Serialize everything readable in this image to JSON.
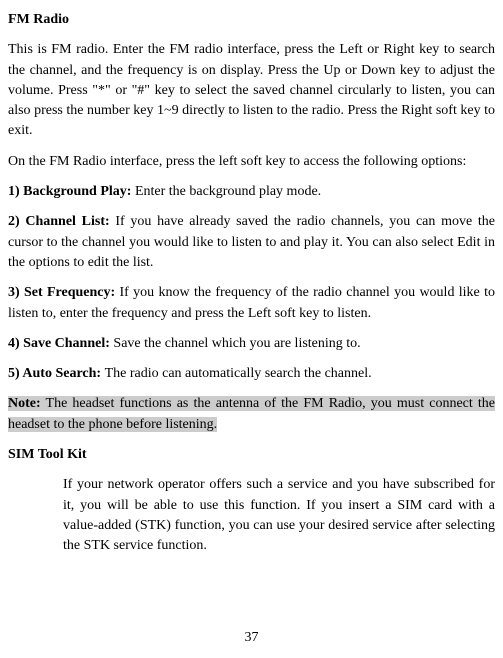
{
  "doc": {
    "title": "FM Radio",
    "intro": "This is FM radio. Enter the FM radio interface, press the Left or Right key to search the channel, and the frequency is on display. Press the Up or Down key to adjust the volume. Press \"*\" or \"#\" key to select the saved channel circularly to listen, you can also press the number key 1~9 directly to listen to the radio. Press the Right soft key to exit.",
    "lead": "On the FM Radio interface, press the left soft key to access the following options:",
    "items": [
      {
        "label": "1) Background Play: ",
        "text": "Enter the background play mode."
      },
      {
        "label": "2) Channel List: ",
        "text": "If you have already saved the radio channels, you can move the cursor to the channel you would like to listen to and play it. You can also select Edit in the options to edit the list."
      },
      {
        "label": "3) Set Frequency: ",
        "text": "If you know the frequency of the radio channel you would like to listen to, enter the frequency and press the Left soft key to listen."
      },
      {
        "label": "4) Save Channel: ",
        "text": "Save the channel which you are listening to."
      },
      {
        "label": "5) Auto Search: ",
        "text": "The radio can automatically search the channel."
      }
    ],
    "note_label": "Note:",
    "note_text": " The headset functions as the antenna of the FM Radio, you must connect the headset to the phone before listening.",
    "section2_title": "SIM Tool Kit",
    "section2_body": "If your network operator offers such a service and you have subscribed for it, you will be able to use this function. If you insert a SIM card with a value-added (STK) function, you can use your desired service after selecting the STK service function.",
    "page_number": "37"
  }
}
